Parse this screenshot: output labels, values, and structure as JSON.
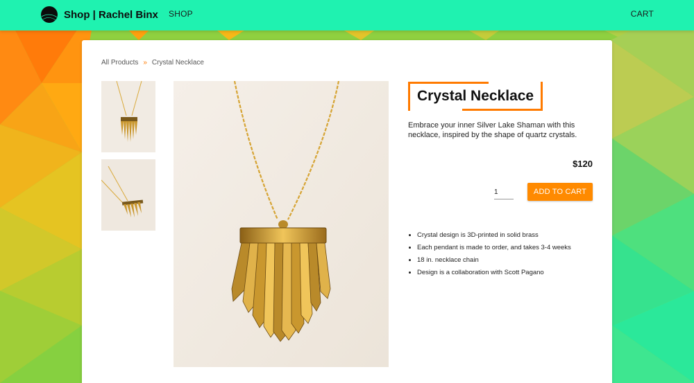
{
  "header": {
    "brand": "Shop | Rachel Binx",
    "nav_shop": "SHOP",
    "nav_cart": "CART",
    "bar_color": "#1ff2b0"
  },
  "breadcrumb": {
    "items": [
      "All Products",
      "Crystal Necklace"
    ],
    "separator": "»"
  },
  "product": {
    "title": "Crystal Necklace",
    "description": "Embrace your inner Silver Lake Shaman with this necklace, inspired by the shape of quartz crystals.",
    "price": "$120",
    "quantity": "1",
    "add_to_cart": "ADD TO CART",
    "features": [
      "Crystal design is 3D-printed in solid brass",
      "Each pendant is made to order, and takes 3-4 weeks",
      "18 in. necklace chain",
      "Design is a collaboration with Scott Pagano"
    ],
    "images": [
      "necklace-front-thumbnail",
      "necklace-angle-thumbnail",
      "necklace-main-photo"
    ]
  },
  "colors": {
    "accent": "#ff8a00",
    "header": "#1ff2b0",
    "gold": "#d9a93a"
  }
}
